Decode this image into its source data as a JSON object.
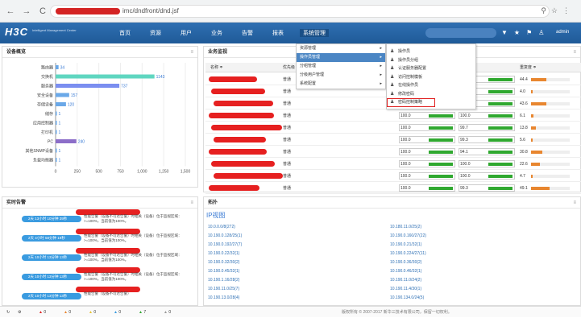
{
  "browser": {
    "url_suffix": "imc/dndfront/dnd.jsf",
    "back": "←",
    "forward": "→",
    "reload": "C",
    "home": "⌂"
  },
  "header": {
    "logo": "H3C",
    "logo_sub": "Intelligent Management Center",
    "nav": [
      "首页",
      "资源",
      "用户",
      "业务",
      "告警",
      "报表",
      "系统管理"
    ],
    "active_nav": "系统管理",
    "admin": "admin"
  },
  "device_panel": {
    "title": "设备概览",
    "categories": [
      "路由器",
      "交换机",
      "服务器",
      "安全设备",
      "存储设备",
      "储存",
      "应用控制器",
      "打印机",
      "PC",
      "其他SNMP设备",
      "负载均衡器"
    ],
    "values": [
      34,
      1143,
      737,
      157,
      120,
      1,
      1,
      1,
      240,
      1,
      1
    ],
    "colors": [
      "#6aa8e8",
      "#5fd6c0",
      "#7b8ef0",
      "#6aa8e8",
      "#6aa8e8",
      "#6aa8e8",
      "#6aa8e8",
      "#6aa8e8",
      "#8c6ec8",
      "#6aa8e8",
      "#6aa8e8"
    ],
    "xticks": [
      "0",
      "250",
      "500",
      "750",
      "1,000",
      "1,250",
      "1,500"
    ],
    "xmax": 1500
  },
  "business_panel": {
    "title": "业务监视",
    "col_name": "名称 ≑",
    "col_priority": "优先级",
    "col_load": "重复度 ≑",
    "rows": [
      {
        "priority": "普通",
        "p1": "100.0",
        "p2": "100.0",
        "val": "44.4",
        "bar": 0.4
      },
      {
        "priority": "普通",
        "p1": "100.0",
        "p2": "100.0",
        "val": "4.0",
        "bar": 0.05
      },
      {
        "priority": "普通",
        "p1": "100.0",
        "p2": "100.0",
        "val": "43.6",
        "bar": 0.4
      },
      {
        "priority": "普通",
        "p1": "100.0",
        "p2": "100.0",
        "val": "6.1",
        "bar": 0.06
      },
      {
        "priority": "普通",
        "p1": "100.0",
        "p2": "99.7",
        "val": "13.8",
        "bar": 0.13
      },
      {
        "priority": "普通",
        "p1": "100.0",
        "p2": "99.3",
        "val": "5.6",
        "bar": 0.05
      },
      {
        "priority": "普通",
        "p1": "100.0",
        "p2": "94.1",
        "val": "30.8",
        "bar": 0.3
      },
      {
        "priority": "普通",
        "p1": "100.0",
        "p2": "100.0",
        "val": "22.6",
        "bar": 0.22
      },
      {
        "priority": "普通",
        "p1": "100.0",
        "p2": "100.0",
        "val": "4.7",
        "bar": 0.05
      },
      {
        "priority": "普通",
        "p1": "100.0",
        "p2": "99.3",
        "val": "49.1",
        "bar": 0.48
      }
    ]
  },
  "dropdown": {
    "items": [
      "资源管理",
      "操作员管理",
      "分组管理",
      "分级用户管理",
      "系统配置"
    ],
    "active": "操作员管理",
    "submenu": [
      "操作员",
      "操作员分组",
      "认证服务器配置",
      "访问控制模板",
      "在线操作员",
      "修改密码",
      "密码控制策略"
    ],
    "highlighted": "密码控制策略"
  },
  "alarm_panel": {
    "title": "实时告警",
    "items": [
      {
        "time": "2天 13小时 10分钟 39秒",
        "text": "性能告警（设备不可达告警）时相关（设备）位于监视区域：>=100%，当前值为100%。"
      },
      {
        "time": "2天 4小时 58分钟 19秒",
        "text": "性能告警（设备不可达告警）时相关（设备）位于监视区域：>=100%，当前值为100%。"
      },
      {
        "time": "2天 10小时 13分钟 13秒",
        "text": "性能告警（设备不可达告警）时相关（设备）位于监视区域：>=100%，当前值为100%。"
      },
      {
        "time": "2天 10小时 13分钟 13秒",
        "text": "性能告警（设备不可达告警）时相关（设备）位于监视区域：>=100%，当前值为100%。"
      },
      {
        "time": "2天 10小时 13分钟 13秒",
        "text": "性能告警（设备不可达告警）"
      }
    ]
  },
  "ip_panel": {
    "title": "拓扑",
    "heading": "IP视图",
    "left": [
      "10.0.0.0/8(272)",
      "10.190.0.128/25(1)",
      "10.190.0.192/27(7)",
      "10.190.0.22/32(1)",
      "10.190.0.32/30(2)",
      "10.190.0.45/32(1)",
      "10.190.1.16/28(2)",
      "10.190.11.0/25(7)",
      "10.190.13.0/28(4)"
    ],
    "right": [
      "10.180.11.0/25(2)",
      "10.190.0.160/27(22)",
      "10.190.0.21/32(1)",
      "10.190.0.224/27(11)",
      "10.190.0.36/30(2)",
      "10.190.0.46/32(1)",
      "10.190.11.0/24(2)",
      "10.190.11.4/30(1)",
      "10.190.134.0/24(5)"
    ]
  },
  "status": {
    "counts": [
      "0",
      "0",
      "0",
      "0",
      "7",
      "0"
    ],
    "colors": [
      "#e02020",
      "#e8862f",
      "#e8c22f",
      "#3a9be0",
      "#2fa82f",
      "#999999"
    ],
    "footer": "版权所有 © 2007-2017 新华三技术有限公司，保留一切权利。"
  }
}
